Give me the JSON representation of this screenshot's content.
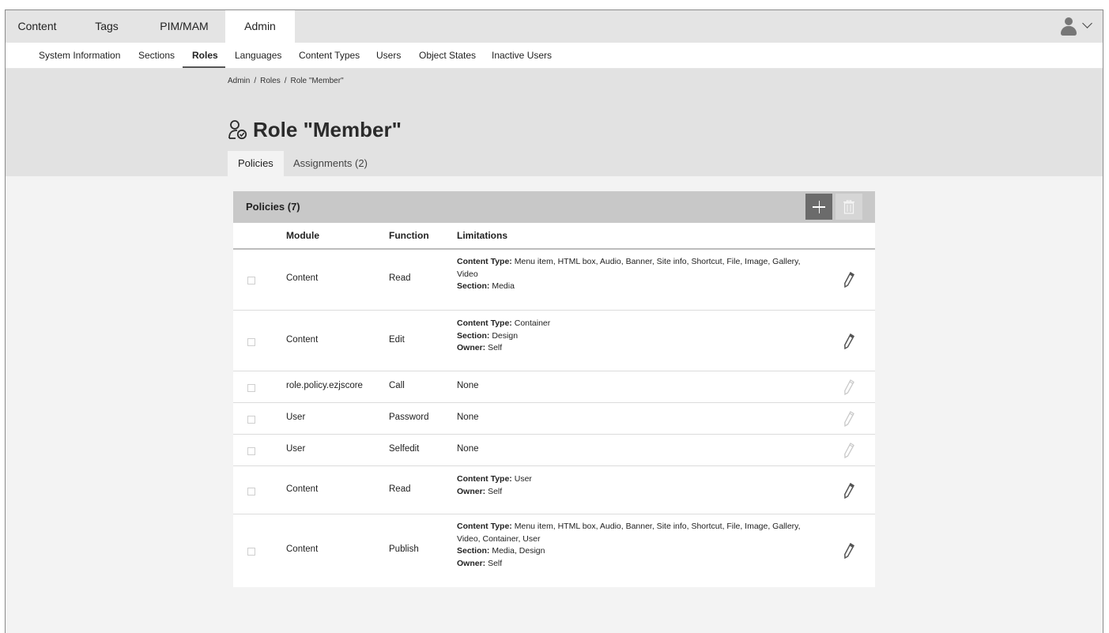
{
  "top_nav": {
    "tabs": [
      {
        "label": "Content",
        "active": false
      },
      {
        "label": "Tags",
        "active": false
      },
      {
        "label": "PIM/MAM",
        "active": false
      },
      {
        "label": "Admin",
        "active": true
      }
    ],
    "user_icon": "user-avatar-icon",
    "menu_icon": "chevron-down-icon"
  },
  "sub_nav": {
    "items": [
      {
        "label": "System Information",
        "active": false
      },
      {
        "label": "Sections",
        "active": false
      },
      {
        "label": "Roles",
        "active": true
      },
      {
        "label": "Languages",
        "active": false
      },
      {
        "label": "Content Types",
        "active": false
      },
      {
        "label": "Users",
        "active": false
      },
      {
        "label": "Object States",
        "active": false
      },
      {
        "label": "Inactive Users",
        "active": false
      }
    ]
  },
  "breadcrumb": [
    "Admin",
    "Roles",
    "Role \"Member\""
  ],
  "page": {
    "title": "Role \"Member\"",
    "icon": "role-icon",
    "tabs": [
      {
        "label": "Policies",
        "active": true
      },
      {
        "label": "Assignments (2)",
        "active": false
      }
    ]
  },
  "policies": {
    "title": "Policies (7)",
    "add_icon": "plus-icon",
    "delete_icon": "trash-icon",
    "columns": {
      "module": "Module",
      "function": "Function",
      "limitations": "Limitations"
    },
    "rows": [
      {
        "module": "Content",
        "function": "Read",
        "editable": true,
        "limitations": [
          {
            "label": "Content Type:",
            "value": "Menu item, HTML box, Audio, Banner, Site info, Shortcut, File, Image, Gallery, Video"
          },
          {
            "label": "Section:",
            "value": "Media"
          }
        ]
      },
      {
        "module": "Content",
        "function": "Edit",
        "editable": true,
        "limitations": [
          {
            "label": "Content Type:",
            "value": "Container"
          },
          {
            "label": "Section:",
            "value": "Design"
          },
          {
            "label": "Owner:",
            "value": "Self"
          }
        ]
      },
      {
        "module": "role.policy.ezjscore",
        "function": "Call",
        "editable": false,
        "limitations_text": "None"
      },
      {
        "module": "User",
        "function": "Password",
        "editable": false,
        "limitations_text": "None"
      },
      {
        "module": "User",
        "function": "Selfedit",
        "editable": false,
        "limitations_text": "None"
      },
      {
        "module": "Content",
        "function": "Read",
        "editable": true,
        "limitations": [
          {
            "label": "Content Type:",
            "value": "User"
          },
          {
            "label": "Owner:",
            "value": "Self"
          }
        ]
      },
      {
        "module": "Content",
        "function": "Publish",
        "editable": true,
        "limitations": [
          {
            "label": "Content Type:",
            "value": "Menu item, HTML box, Audio, Banner, Site info, Shortcut, File, Image, Gallery, Video, Container, User"
          },
          {
            "label": "Section:",
            "value": "Media, Design"
          },
          {
            "label": "Owner:",
            "value": "Self"
          }
        ]
      }
    ],
    "edit_icon": "pencil-icon"
  }
}
